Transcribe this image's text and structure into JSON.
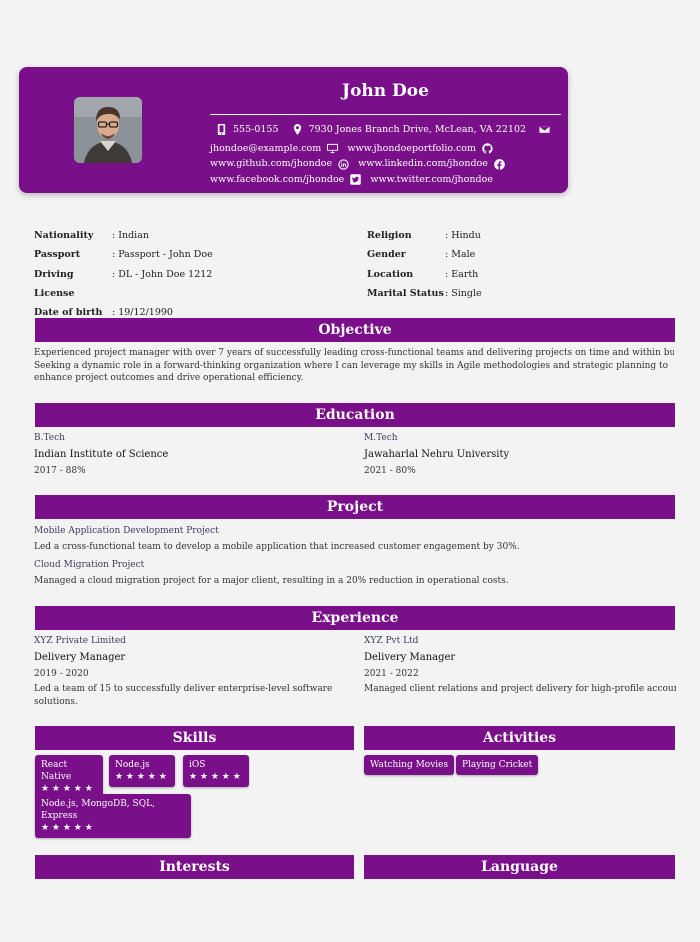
{
  "profile": {
    "name": "John Doe",
    "contact": {
      "phone": "555-0155",
      "address": "7930 Jones Branch Drive, McLean, VA 22102",
      "email": "jhondoe@example.com",
      "website": "www.jhondoeportfolio.com",
      "github": "www.github.com/jhondoe",
      "linkedin": "www.linkedin.com/jhondoe",
      "facebook": "www.facebook.com/jhondoe",
      "twitter": "www.twitter.com/jhondoe"
    }
  },
  "details_left": [
    {
      "label": "Nationality",
      "value": ": Indian"
    },
    {
      "label": "Passport",
      "value": ": Passport - John Doe"
    },
    {
      "label": "Driving License",
      "value": ": DL - John Doe 1212"
    },
    {
      "label": "Date of birth",
      "value": ": 19/12/1990"
    }
  ],
  "details_right": [
    {
      "label": "Religion",
      "value": ": Hindu"
    },
    {
      "label": "Gender",
      "value": ": Male"
    },
    {
      "label": "Location",
      "value": ": Earth"
    },
    {
      "label": "Marital Status",
      "value": ": Single"
    }
  ],
  "sections": {
    "objective": "Objective",
    "education": "Education",
    "project": "Project",
    "experience": "Experience",
    "skills": "Skills",
    "activities": "Activities",
    "interests": "Interests",
    "language": "Language"
  },
  "objective": {
    "line1": "Experienced project manager with over 7 years of successfully leading cross-functional teams and delivering projects on time and within budg",
    "line2": "Seeking a dynamic role in a forward-thinking organization where I can leverage my skills in Agile methodologies and strategic planning to",
    "line3": "enhance project outcomes and drive operational efficiency."
  },
  "education": [
    {
      "degree": "B.Tech",
      "school": "Indian Institute of Science",
      "meta": "2017 - 88%"
    },
    {
      "degree": "M.Tech",
      "school": "Jawaharlal Nehru University",
      "meta": "2021 - 80%"
    }
  ],
  "projects": [
    {
      "title": "Mobile Application Development Project",
      "desc": "Led a cross-functional team to develop a mobile application that increased customer engagement by 30%."
    },
    {
      "title": "Cloud Migration Project",
      "desc": "Managed a cloud migration project for a major client, resulting in a 20% reduction in operational costs."
    }
  ],
  "experience": [
    {
      "company": "XYZ Private Limited",
      "role": "Delivery Manager",
      "period": "2019 - 2020",
      "desc1": "Led a team of 15 to successfully deliver enterprise-level software",
      "desc2": "solutions."
    },
    {
      "company": "XYZ Pvt Ltd",
      "role": "Delivery Manager",
      "period": "2021 - 2022",
      "desc1": "Managed client relations and project delivery for high-profile accoun",
      "desc2": ""
    }
  ],
  "skills": [
    {
      "name": "React Native",
      "stars": "★ ★ ★ ★ ★",
      "rating": 5
    },
    {
      "name": "Node.js",
      "stars": "★ ★ ★ ★ ★",
      "rating": 5
    },
    {
      "name": "iOS",
      "stars": "★ ★ ★ ★ ★",
      "rating": 5
    },
    {
      "name": "Node.js, MongoDB, SQL, Express",
      "stars": "★ ★ ★ ★ ★",
      "rating": 5
    }
  ],
  "activities": [
    "Watching Movies",
    "Playing Cricket"
  ],
  "colors": {
    "accent": "#7a0f8a",
    "background": "#f3f3f3"
  },
  "icons": [
    "mobile-phone-icon",
    "map-marker-icon",
    "envelope-icon",
    "monitor-icon",
    "github-icon",
    "linkedin-icon",
    "facebook-icon",
    "twitter-icon"
  ]
}
